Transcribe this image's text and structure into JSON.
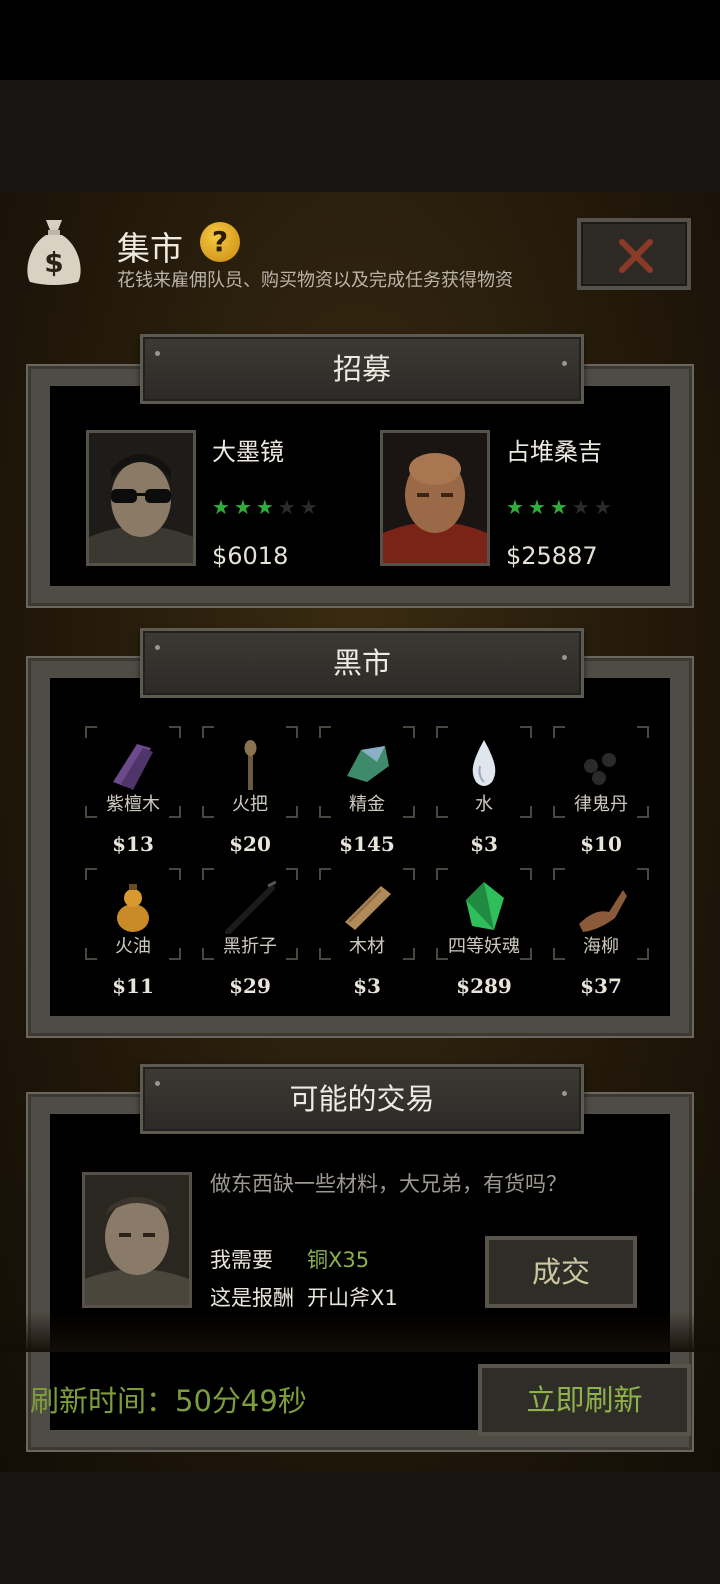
{
  "header": {
    "title": "集市",
    "help": "?",
    "subtitle": "花钱来雇佣队员、购买物资以及完成任务获得物资",
    "icon": "money-bag-icon"
  },
  "recruit": {
    "title": "招募",
    "candidates": [
      {
        "name": "大墨镜",
        "stars": 3,
        "max_stars": 5,
        "price": "$6018"
      },
      {
        "name": "占堆桑吉",
        "stars": 3,
        "max_stars": 5,
        "price": "$25887"
      }
    ]
  },
  "black_market": {
    "title": "黑市",
    "items": [
      {
        "name": "紫檀木",
        "price": "$13",
        "icon": "purple-wood-icon"
      },
      {
        "name": "火把",
        "price": "$20",
        "icon": "torch-icon"
      },
      {
        "name": "精金",
        "price": "$145",
        "icon": "ore-icon"
      },
      {
        "name": "水",
        "price": "$3",
        "icon": "water-drop-icon"
      },
      {
        "name": "律鬼丹",
        "price": "$10",
        "icon": "pills-icon"
      },
      {
        "name": "火油",
        "price": "$11",
        "icon": "oil-gourd-icon"
      },
      {
        "name": "黑折子",
        "price": "$29",
        "icon": "black-stick-icon"
      },
      {
        "name": "木材",
        "price": "$3",
        "icon": "wood-plank-icon"
      },
      {
        "name": "四等妖魂",
        "price": "$289",
        "icon": "green-gem-icon"
      },
      {
        "name": "海柳",
        "price": "$37",
        "icon": "driftwood-icon"
      }
    ]
  },
  "trade": {
    "title": "可能的交易",
    "message": "做东西缺一些材料，大兄弟，有货吗？",
    "need_label": "我需要",
    "need_value": "铜X35",
    "reward_label": "这是报酬",
    "reward_value": "开山斧X1",
    "deal_button": "成交"
  },
  "footer": {
    "refresh_label": "刷新时间：",
    "refresh_time": "50分49秒",
    "refresh_button": "立即刷新"
  },
  "colors": {
    "star_filled": "#2fae3a",
    "star_empty": "#2a2a2a",
    "accent_green": "#8fb04a",
    "need_green": "#8db04c"
  }
}
